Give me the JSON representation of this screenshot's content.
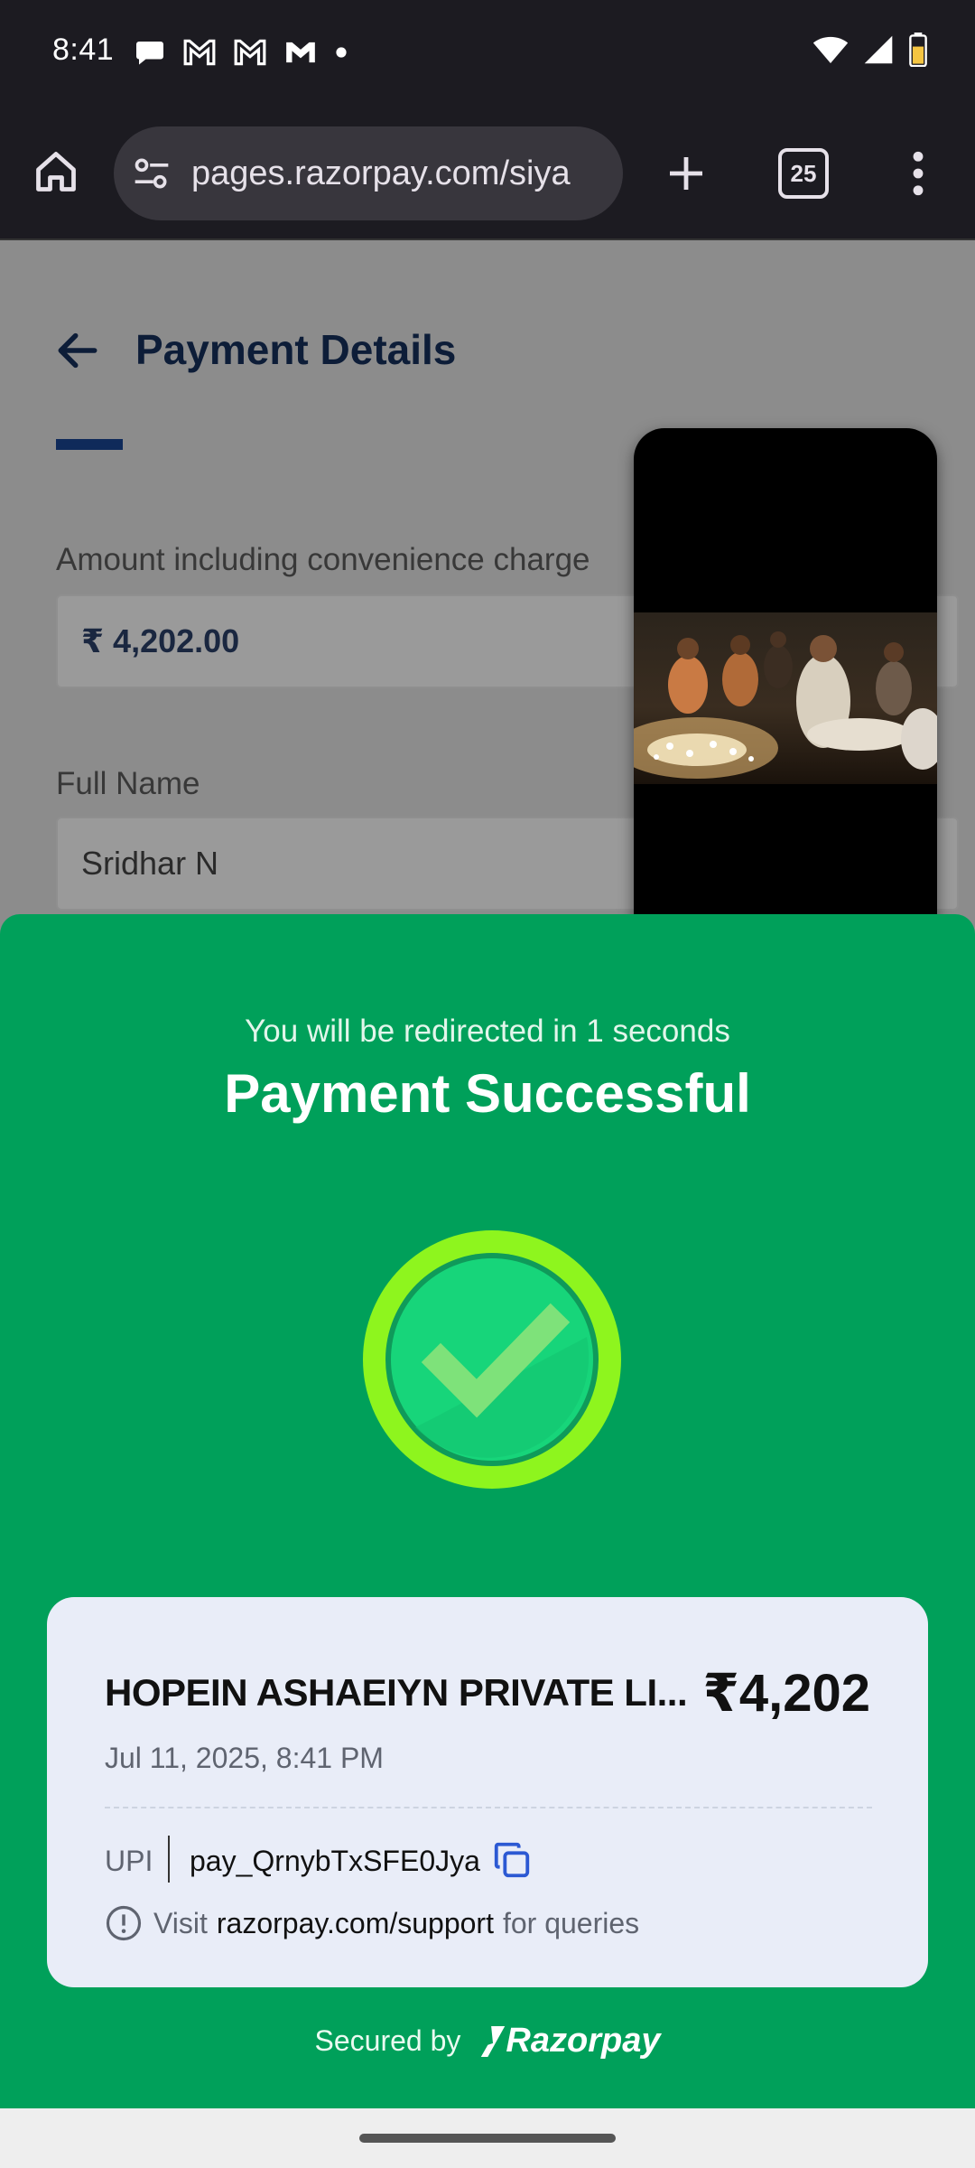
{
  "status_bar": {
    "time": "8:41",
    "left_icons": [
      "chat-bubble-icon",
      "gmail-icon",
      "gmail-icon",
      "gmail-dark-icon",
      "dot-icon"
    ],
    "right_icons": [
      "wifi-icon",
      "signal-icon",
      "battery-icon"
    ]
  },
  "browser": {
    "url": "pages.razorpay.com/siya",
    "tab_count": "25"
  },
  "page": {
    "title": "Payment Details",
    "amount_label": "Amount including convenience charge",
    "amount_value": "₹ 4,202.00",
    "name_label": "Full Name",
    "name_value": "Sridhar N"
  },
  "success": {
    "redirect_text": "You will be redirected in 1 seconds",
    "title": "Payment Successful",
    "merchant": "HOPEIN ASHAEIYN PRIVATE LI...",
    "amount": "₹4,202",
    "datetime": "Jul 11, 2025, 8:41 PM",
    "method": "UPI",
    "payment_id": "pay_QrnybTxSFE0Jya",
    "support_prefix": "Visit",
    "support_link": "razorpay.com/support",
    "support_suffix": "for queries",
    "secured_by": "Secured by",
    "brand": "Razorpay"
  },
  "colors": {
    "sheet_green": "#00a05a",
    "check_ring": "#8ef51e",
    "check_fill": "#17d57a",
    "card_bg": "#e9edf8",
    "copy_icon_blue": "#2c59d3"
  }
}
